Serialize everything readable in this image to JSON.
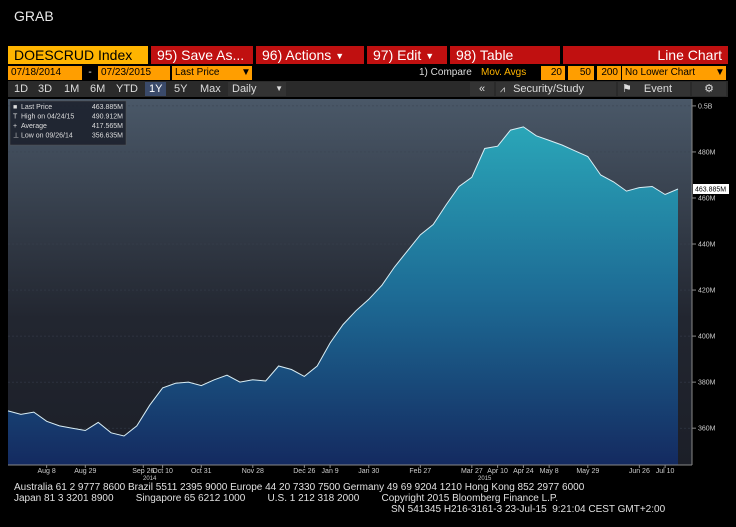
{
  "window": {
    "title": "GRAB"
  },
  "toolbar": {
    "ticker": "DOESCRUD Index",
    "save": "95) Save As...",
    "actions": "96) Actions",
    "edit": "97) Edit",
    "table": "98) Table",
    "chart_type": "Line Chart"
  },
  "settings": {
    "start_date": "07/18/2014",
    "dash": "-",
    "end_date": "07/23/2015",
    "field": "Last Price",
    "compare": "1) Compare",
    "mov_avgs": "Mov. Avgs",
    "ma1": "20",
    "ma2": "50",
    "ma3": "200",
    "lower_chart": "No Lower Chart"
  },
  "periods": {
    "items": [
      "1D",
      "3D",
      "1M",
      "6M",
      "YTD",
      "1Y",
      "5Y",
      "Max"
    ],
    "selected": "1Y",
    "frequency": "Daily",
    "collapse": "«",
    "security_study": "Security/Study",
    "event": "Event",
    "gear": "⚙"
  },
  "legend": {
    "items": [
      {
        "symbol": "■",
        "label": "Last Price",
        "value": "463.885M"
      },
      {
        "symbol": "T",
        "label": "High on 04/24/15",
        "value": "490.912M"
      },
      {
        "symbol": "+",
        "label": "Average",
        "value": "417.565M"
      },
      {
        "symbol": "⊥",
        "label": "Low on 09/26/14",
        "value": "356.635M"
      }
    ]
  },
  "last_price_tag": "463.885M",
  "chart_data": {
    "type": "area",
    "yticks": [
      {
        "v": 500,
        "label": "0.5B"
      },
      {
        "v": 480,
        "label": "480M"
      },
      {
        "v": 460,
        "label": "460M"
      },
      {
        "v": 440,
        "label": "440M"
      },
      {
        "v": 420,
        "label": "420M"
      },
      {
        "v": 400,
        "label": "400M"
      },
      {
        "v": 380,
        "label": "380M"
      },
      {
        "v": 360,
        "label": "360M"
      }
    ],
    "ylim": [
      344,
      503
    ],
    "xticks": [
      {
        "i": 3,
        "label": "Aug 8"
      },
      {
        "i": 6,
        "label": "Aug 29"
      },
      {
        "i": 10.5,
        "label": "Sep 26"
      },
      {
        "i": 12,
        "label": "Oct 10"
      },
      {
        "i": 15,
        "label": "Oct 31"
      },
      {
        "i": 19,
        "label": "Nov 28"
      },
      {
        "i": 23,
        "label": "Dec 26"
      },
      {
        "i": 25,
        "label": "Jan 9"
      },
      {
        "i": 28,
        "label": "Jan 30"
      },
      {
        "i": 32,
        "label": "Feb 27"
      },
      {
        "i": 36,
        "label": "Mar 27"
      },
      {
        "i": 38,
        "label": "Apr 10"
      },
      {
        "i": 40,
        "label": "Apr 24"
      },
      {
        "i": 42,
        "label": "May 8"
      },
      {
        "i": 45,
        "label": "May 29"
      },
      {
        "i": 49,
        "label": "Jun 26"
      },
      {
        "i": 51,
        "label": "Jul 10"
      }
    ],
    "year_labels": [
      {
        "i": 11,
        "label": "2014"
      },
      {
        "i": 37,
        "label": "2015"
      }
    ],
    "values": [
      367.5,
      366.0,
      367.0,
      363.0,
      361.0,
      360.0,
      359.0,
      362.5,
      358.0,
      356.6,
      361.0,
      370.0,
      377.5,
      379.5,
      380.0,
      378.5,
      381.0,
      383.0,
      380.0,
      381.0,
      380.5,
      387.0,
      385.5,
      382.5,
      387.0,
      397.0,
      405.0,
      411.0,
      416.0,
      422.0,
      430.0,
      437.0,
      444.0,
      448.5,
      457.0,
      465.0,
      469.0,
      481.5,
      482.5,
      489.5,
      490.9,
      487.0,
      485.0,
      483.0,
      480.5,
      478.0,
      470.0,
      467.0,
      463.0,
      464.5,
      465.0,
      461.5,
      463.9
    ]
  },
  "footer": {
    "line1": "Australia 61 2 9777 8600 Brazil 5511 2395 9000 Europe 44 20 7330 7500 Germany 49 69 9204 1210 Hong Kong 852 2977 6000",
    "line2": "Japan 81 3 3201 8900        Singapore 65 6212 1000        U.S. 1 212 318 2000        Copyright 2015 Bloomberg Finance L.P.",
    "line3": "SN 541345 H216-3161-3 23-Jul-15  9:21:04 CEST GMT+2:00"
  }
}
